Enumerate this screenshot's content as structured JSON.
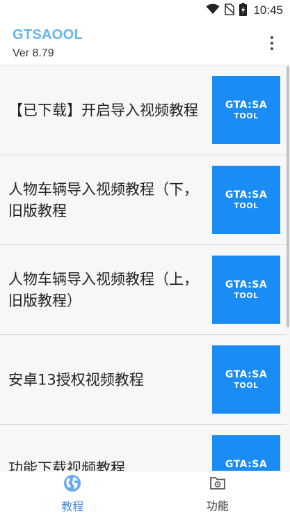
{
  "status_bar": {
    "time": "10:45",
    "icons": [
      "wifi-icon",
      "no-sim-icon",
      "battery-charging-icon"
    ]
  },
  "app_bar": {
    "title": "GTSAOOL",
    "version": "Ver 8.79",
    "overflow_icon": "more-vert-icon"
  },
  "colors": {
    "title": "#64b5f6",
    "thumbnail_bg": "#1a8cf5",
    "nav_active": "#4a90e2"
  },
  "thumbnail": {
    "line1": "GTA:SA",
    "line2": "TOOL"
  },
  "list": {
    "items": [
      {
        "title": "【已下载】开启导入视频教程"
      },
      {
        "title": "人物车辆导入视频教程（下，旧版教程"
      },
      {
        "title": "人物车辆导入视频教程（上，旧版教程）"
      },
      {
        "title": "安卓13授权视频教程"
      },
      {
        "title": "功能下载视频教程"
      }
    ]
  },
  "bottom_nav": {
    "tabs": [
      {
        "label": "教程",
        "icon": "globe-icon",
        "active": true
      },
      {
        "label": "功能",
        "icon": "folder-settings-icon",
        "active": false
      }
    ]
  }
}
